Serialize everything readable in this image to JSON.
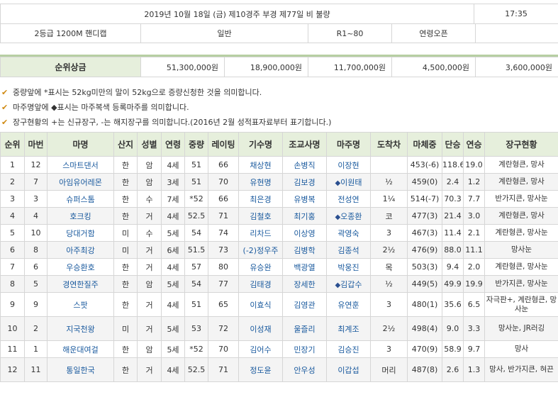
{
  "race_info": {
    "title": "2019년 10월 18일 (금) 제10경주 부경 제77일  비 불량",
    "time": "17:35",
    "grade": "2등급   1200M 핸디캡",
    "type": "일반",
    "rating_range": "R1~80",
    "age_cond": "연령오픈"
  },
  "prize": {
    "label": "순위상금",
    "amounts": [
      "51,300,000원",
      "18,900,000원",
      "11,700,000원",
      "4,500,000원",
      "3,600,000원"
    ]
  },
  "notes": [
    "중량앞에 *표시는 52kg미만의 말이 52kg으로 증량신청한 것을 의미합니다.",
    "마주명앞에 ◆표시는 마주복색 등록마주를 의미합니다.",
    "장구현황의 +는 신규장구, -는 해지장구를 의미합니다.(2016년 2월 성적표자료부터 표기합니다.)"
  ],
  "columns": [
    "순위",
    "마번",
    "마명",
    "산지",
    "성별",
    "연령",
    "중량",
    "레이팅",
    "기수명",
    "조교사명",
    "마주명",
    "도착차",
    "마체중",
    "단승",
    "연승",
    "장구현황"
  ],
  "rows": [
    {
      "rank": "1",
      "num": "12",
      "horse": "스마트댄서",
      "origin": "한",
      "sex": "암",
      "age": "4세",
      "weight": "51",
      "rating": "66",
      "jockey": "채상현",
      "trainer": "손병직",
      "owner_mark": "",
      "owner": "이장현",
      "margin": "",
      "body_wt": "453(-6)",
      "win": "118.6",
      "place": "19.0",
      "gear": "계란형큰, 망사"
    },
    {
      "rank": "2",
      "num": "7",
      "horse": "아임유어레몬",
      "origin": "한",
      "sex": "암",
      "age": "3세",
      "weight": "51",
      "rating": "70",
      "jockey": "유현명",
      "trainer": "김보경",
      "owner_mark": "◆",
      "owner": "이원태",
      "margin": "½",
      "body_wt": "459(0)",
      "win": "2.4",
      "place": "1.2",
      "gear": "계란형큰, 망사"
    },
    {
      "rank": "3",
      "num": "3",
      "horse": "슈퍼스톰",
      "origin": "한",
      "sex": "수",
      "age": "7세",
      "weight": "*52",
      "rating": "66",
      "jockey": "최은경",
      "trainer": "유병복",
      "owner_mark": "",
      "owner": "전성연",
      "margin": "1¼",
      "body_wt": "514(-7)",
      "win": "70.3",
      "place": "7.7",
      "gear": "반가지큰, 망사눈"
    },
    {
      "rank": "4",
      "num": "4",
      "horse": "호크킹",
      "origin": "한",
      "sex": "거",
      "age": "4세",
      "weight": "52.5",
      "rating": "71",
      "jockey": "김철호",
      "trainer": "최기홍",
      "owner_mark": "◆",
      "owner": "오종환",
      "margin": "코",
      "body_wt": "477(3)",
      "win": "21.4",
      "place": "3.0",
      "gear": "계란형큰, 망사"
    },
    {
      "rank": "5",
      "num": "10",
      "horse": "당대거함",
      "origin": "미",
      "sex": "수",
      "age": "5세",
      "weight": "54",
      "rating": "74",
      "jockey": "리차드",
      "trainer": "이상영",
      "owner_mark": "",
      "owner": "곽영숙",
      "margin": "3",
      "body_wt": "467(3)",
      "win": "11.4",
      "place": "2.1",
      "gear": "계란형큰, 망사눈"
    },
    {
      "rank": "6",
      "num": "8",
      "horse": "아주최강",
      "origin": "미",
      "sex": "거",
      "age": "6세",
      "weight": "51.5",
      "rating": "73",
      "jockey": "(-2)정우주",
      "trainer": "김병학",
      "owner_mark": "",
      "owner": "김종석",
      "margin": "2½",
      "body_wt": "476(9)",
      "win": "88.0",
      "place": "11.1",
      "gear": "망사눈"
    },
    {
      "rank": "7",
      "num": "6",
      "horse": "우승환호",
      "origin": "한",
      "sex": "거",
      "age": "4세",
      "weight": "57",
      "rating": "80",
      "jockey": "유승완",
      "trainer": "백광열",
      "owner_mark": "",
      "owner": "박웅진",
      "margin": "목",
      "body_wt": "503(3)",
      "win": "9.4",
      "place": "2.0",
      "gear": "계란형큰, 망사눈"
    },
    {
      "rank": "8",
      "num": "5",
      "horse": "경연한질주",
      "origin": "한",
      "sex": "암",
      "age": "5세",
      "weight": "54",
      "rating": "77",
      "jockey": "김태경",
      "trainer": "장세한",
      "owner_mark": "◆",
      "owner": "김갑수",
      "margin": "½",
      "body_wt": "449(5)",
      "win": "49.9",
      "place": "19.9",
      "gear": "반가지큰, 망사눈"
    },
    {
      "rank": "9",
      "num": "9",
      "horse": "스팟",
      "origin": "한",
      "sex": "거",
      "age": "4세",
      "weight": "51",
      "rating": "65",
      "jockey": "이효식",
      "trainer": "김영관",
      "owner_mark": "",
      "owner": "유연훈",
      "margin": "3",
      "body_wt": "480(1)",
      "win": "35.6",
      "place": "6.5",
      "gear": "자극판+, 계란형큰, 망사눈"
    },
    {
      "rank": "10",
      "num": "2",
      "horse": "지국천왕",
      "origin": "미",
      "sex": "거",
      "age": "5세",
      "weight": "53",
      "rating": "72",
      "jockey": "이성재",
      "trainer": "울즐리",
      "owner_mark": "",
      "owner": "최계조",
      "margin": "2½",
      "body_wt": "498(4)",
      "win": "9.0",
      "place": "3.3",
      "gear": "망사눈, JR러깅"
    },
    {
      "rank": "11",
      "num": "1",
      "horse": "해운대여걸",
      "origin": "한",
      "sex": "암",
      "age": "5세",
      "weight": "*52",
      "rating": "70",
      "jockey": "김어수",
      "trainer": "민장기",
      "owner_mark": "",
      "owner": "김승진",
      "margin": "3",
      "body_wt": "470(9)",
      "win": "58.9",
      "place": "9.7",
      "gear": "망사"
    },
    {
      "rank": "12",
      "num": "11",
      "horse": "통일한국",
      "origin": "한",
      "sex": "거",
      "age": "4세",
      "weight": "52.5",
      "rating": "71",
      "jockey": "정도윤",
      "trainer": "안우성",
      "owner_mark": "",
      "owner": "이갑섭",
      "margin": "머리",
      "body_wt": "487(8)",
      "win": "2.6",
      "place": "1.3",
      "gear": "망사, 반가지큰, 혀끈"
    }
  ]
}
